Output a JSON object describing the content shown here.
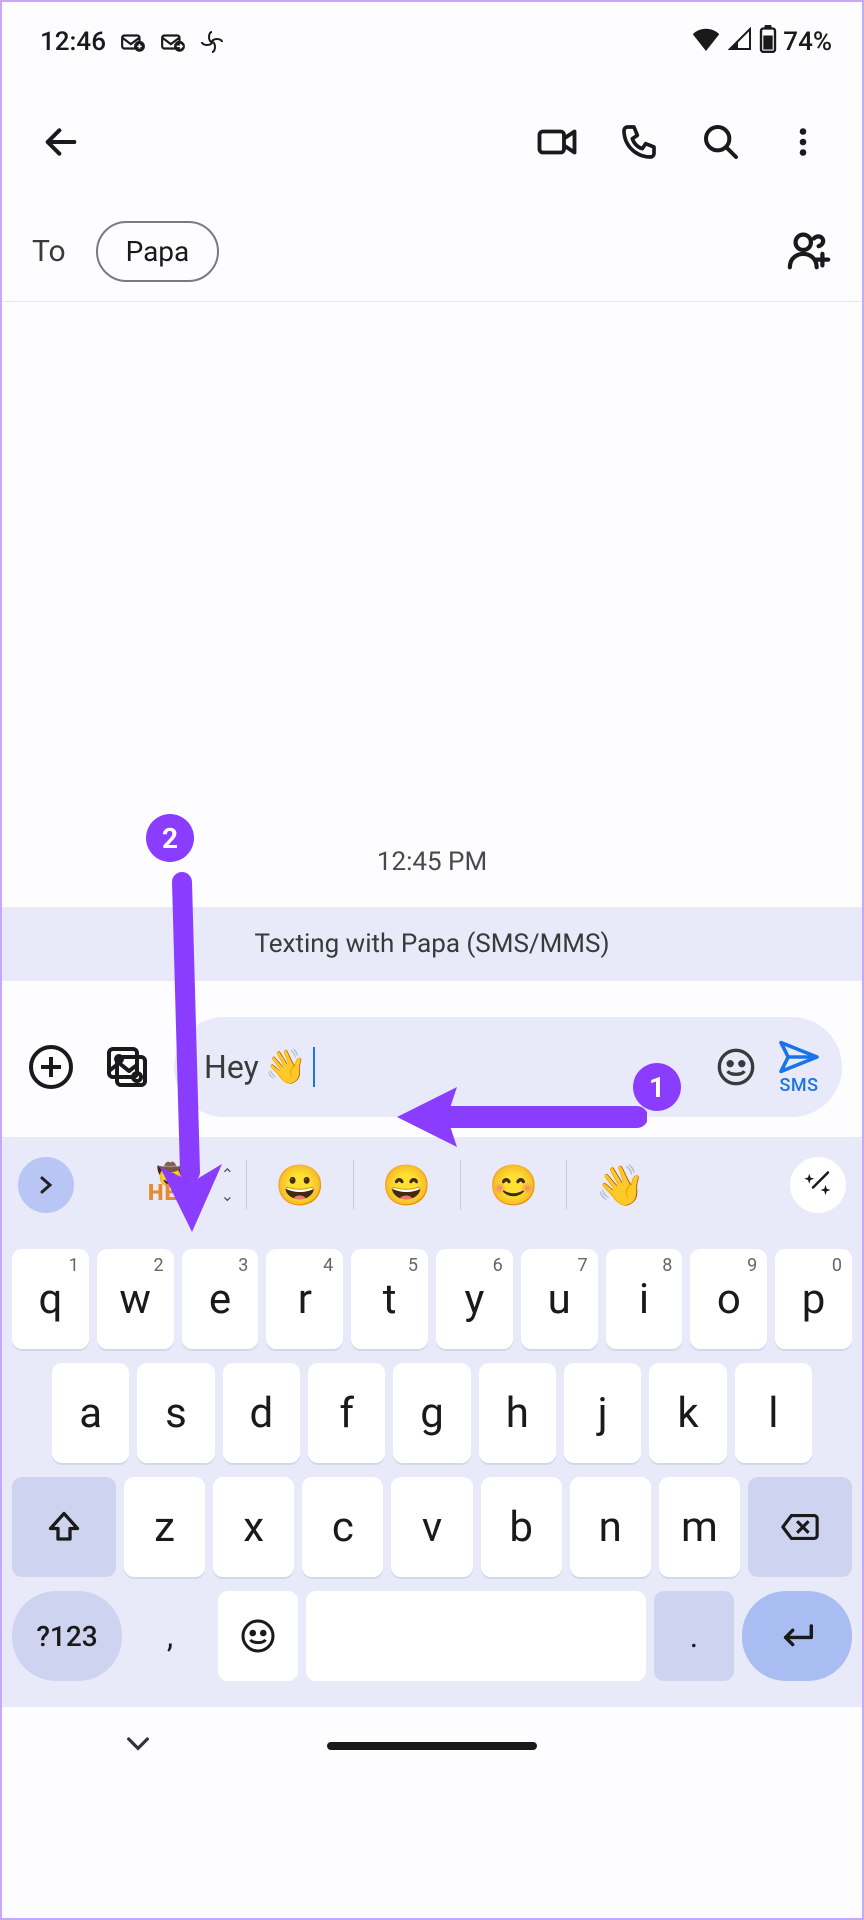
{
  "status": {
    "time": "12:46",
    "battery": "74%"
  },
  "to_row": {
    "label": "To",
    "recipient": "Papa"
  },
  "conversation": {
    "timestamp": "12:45 PM",
    "banner": "Texting with Papa (SMS/MMS)"
  },
  "compose": {
    "text": "Hey",
    "emoji": "👋",
    "send_label": "SMS"
  },
  "suggestions": {
    "hey_label": "HEY",
    "items": [
      "😀",
      "😄",
      "😊",
      "👋"
    ]
  },
  "keyboard": {
    "row1": [
      {
        "main": "q",
        "hint": "1"
      },
      {
        "main": "w",
        "hint": "2"
      },
      {
        "main": "e",
        "hint": "3"
      },
      {
        "main": "r",
        "hint": "4"
      },
      {
        "main": "t",
        "hint": "5"
      },
      {
        "main": "y",
        "hint": "6"
      },
      {
        "main": "u",
        "hint": "7"
      },
      {
        "main": "i",
        "hint": "8"
      },
      {
        "main": "o",
        "hint": "9"
      },
      {
        "main": "p",
        "hint": "0"
      }
    ],
    "row2": [
      "a",
      "s",
      "d",
      "f",
      "g",
      "h",
      "j",
      "k",
      "l"
    ],
    "row3": [
      "z",
      "x",
      "c",
      "v",
      "b",
      "n",
      "m"
    ],
    "symbols": "?123",
    "comma": ",",
    "period": "."
  },
  "annotations": {
    "badge1": "1",
    "badge2": "2"
  }
}
